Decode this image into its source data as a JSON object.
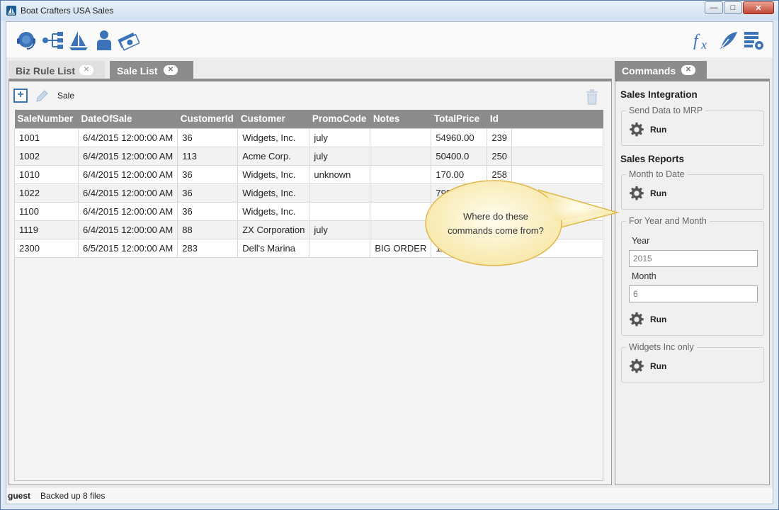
{
  "window": {
    "title": "Boat Crafters USA Sales",
    "controls": {
      "minimize": "—",
      "maximize": "□",
      "close": "✕"
    }
  },
  "toolbar": {
    "left_icons": [
      "support-icon",
      "hierarchy-icon",
      "sailboat-icon",
      "user-icon",
      "money-icon"
    ],
    "right_icons": [
      "function-icon",
      "quill-icon",
      "list-settings-icon"
    ]
  },
  "tabs": {
    "biz_rule": {
      "label": "Biz Rule List",
      "close": "✕"
    },
    "sale_list": {
      "label": "Sale List",
      "close": "✕"
    },
    "commands": {
      "label": "Commands",
      "close": "✕"
    }
  },
  "sale_list": {
    "toolbar_label": "Sale",
    "columns": [
      "SaleNumber",
      "DateOfSale",
      "CustomerId",
      "Customer",
      "PromoCode",
      "Notes",
      "TotalPrice",
      "Id"
    ],
    "rows": [
      [
        "1001",
        "6/4/2015 12:00:00 AM",
        "36",
        "Widgets, Inc.",
        "july",
        "",
        "54960.00",
        "239"
      ],
      [
        "1002",
        "6/4/2015 12:00:00 AM",
        "113",
        "Acme Corp.",
        "july",
        "",
        "50400.0",
        "250"
      ],
      [
        "1010",
        "6/4/2015 12:00:00 AM",
        "36",
        "Widgets, Inc.",
        "unknown",
        "",
        "170.00",
        "258"
      ],
      [
        "1022",
        "6/4/2015 12:00:00 AM",
        "36",
        "Widgets, Inc.",
        "",
        "",
        "790",
        ""
      ],
      [
        "1100",
        "6/4/2015 12:00:00 AM",
        "36",
        "Widgets, Inc.",
        "",
        "",
        "",
        ""
      ],
      [
        "1119",
        "6/4/2015 12:00:00 AM",
        "88",
        "ZX Corporation",
        "july",
        "",
        "",
        ""
      ],
      [
        "2300",
        "6/5/2015 12:00:00 AM",
        "283",
        "Dell's Marina",
        "",
        "BIG ORDER",
        "112",
        ""
      ]
    ]
  },
  "commands": {
    "sales_integration": {
      "heading": "Sales Integration",
      "send_data_title": "Send Data to MRP",
      "run_label": "Run"
    },
    "sales_reports": {
      "heading": "Sales Reports",
      "month_to_date_title": "Month to Date",
      "year_month_title": "For Year and Month",
      "year_label": "Year",
      "year_value": "2015",
      "month_label": "Month",
      "month_value": "6",
      "widgets_title": "Widgets Inc only",
      "run_label": "Run"
    }
  },
  "status": {
    "user": "guest",
    "message": "Backed up 8 files"
  },
  "callout": {
    "line1": "Where do these",
    "line2": "commands  come from?"
  },
  "colors": {
    "header_bg": "#8c8c8c",
    "accent_blue": "#3b72b8",
    "callout_fill": "#fbf3cc",
    "callout_border": "#e0b84c"
  }
}
